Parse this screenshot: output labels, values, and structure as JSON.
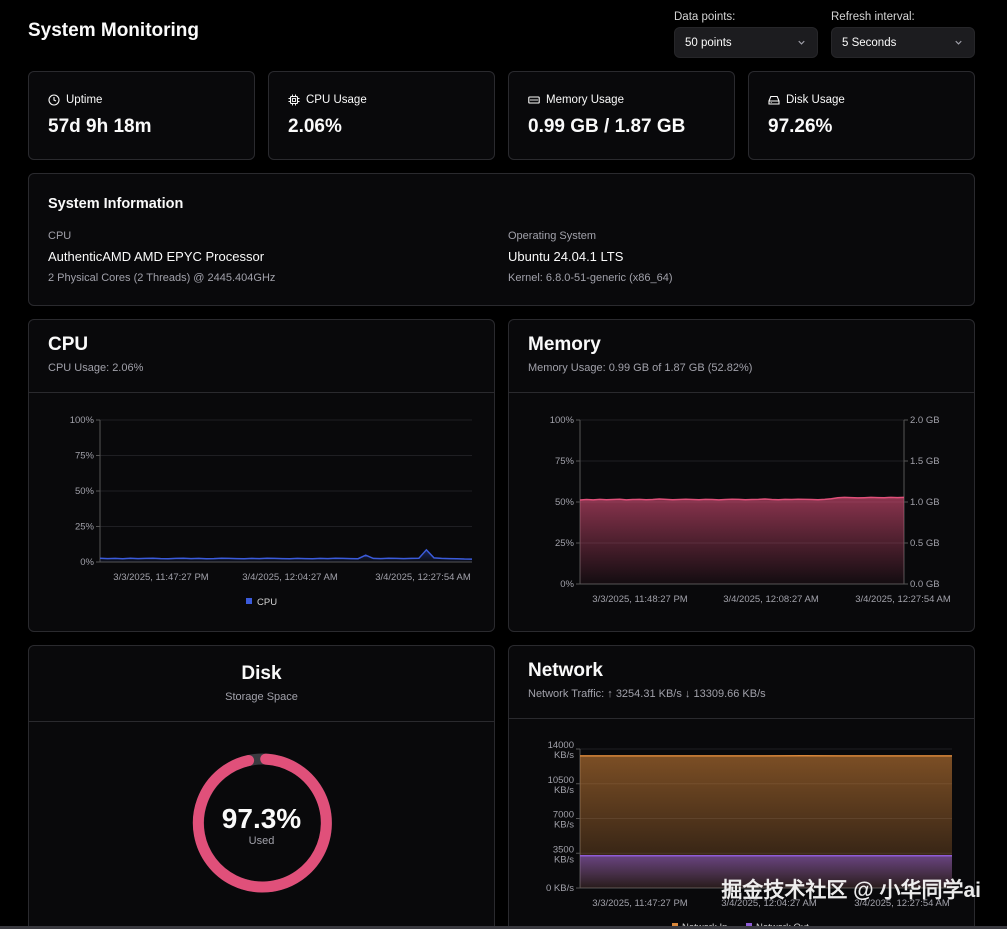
{
  "title": "System Monitoring",
  "controls": {
    "data_points_label": "Data points:",
    "data_points_value": "50 points",
    "refresh_label": "Refresh interval:",
    "refresh_value": "5 Seconds"
  },
  "stats": {
    "uptime": {
      "label": "Uptime",
      "value": "57d 9h 18m",
      "icon": "clock-icon"
    },
    "cpu": {
      "label": "CPU Usage",
      "value": "2.06%",
      "icon": "cpu-icon"
    },
    "memory": {
      "label": "Memory Usage",
      "value": "0.99 GB / 1.87 GB",
      "icon": "memory-icon"
    },
    "disk": {
      "label": "Disk Usage",
      "value": "97.26%",
      "icon": "hard-drive-icon"
    }
  },
  "system_info": {
    "title": "System Information",
    "cpu": {
      "label": "CPU",
      "value": "AuthenticAMD AMD EPYC Processor",
      "detail": "2 Physical Cores (2 Threads) @ 2445.404GHz"
    },
    "os": {
      "label": "Operating System",
      "value": "Ubuntu 24.04.1 LTS",
      "detail": "Kernel: 6.8.0-51-generic (x86_64)"
    }
  },
  "cpu_panel": {
    "title": "CPU",
    "subtitle": "CPU Usage: 2.06%"
  },
  "memory_panel": {
    "title": "Memory",
    "subtitle": "Memory Usage: 0.99 GB of 1.87 GB (52.82%)"
  },
  "disk_panel": {
    "title": "Disk",
    "subtitle": "Storage Space",
    "gauge_value": "97.3%",
    "gauge_label": "Used",
    "used_fraction": 0.973
  },
  "network_panel": {
    "title": "Network",
    "subtitle": "Network Traffic: ↑ 3254.31 KB/s ↓ 13309.66 KB/s"
  },
  "colors": {
    "cpu": "#3b5bdb",
    "memory": "#e0507a",
    "network_in": "#d9873a",
    "network_out": "#8e5bd6",
    "disk": "#e0507a"
  },
  "watermark": "掘金技术社区 @ 小华同学ai",
  "chart_data": [
    {
      "type": "line",
      "name": "cpu",
      "yticks": [
        "0%",
        "25%",
        "50%",
        "75%",
        "100%"
      ],
      "ylim": [
        0,
        100
      ],
      "xticks": [
        "3/3/2025, 11:47:27 PM",
        "3/4/2025, 12:04:27 AM",
        "3/4/2025, 12:27:54 AM"
      ],
      "legend": [
        "CPU"
      ],
      "series": [
        {
          "name": "CPU",
          "values": [
            2.6,
            2.4,
            2.5,
            2.3,
            2.6,
            2.4,
            2.5,
            2.7,
            2.4,
            2.3,
            2.5,
            2.6,
            2.4,
            2.5,
            2.3,
            2.4,
            2.6,
            2.5,
            2.4,
            2.3,
            2.5,
            2.4,
            2.6,
            2.5,
            2.4,
            2.3,
            2.5,
            2.4,
            2.3,
            2.5,
            2.4,
            2.6,
            2.5,
            2.4,
            2.3,
            4.8,
            2.5,
            2.4,
            2.6,
            2.5,
            2.4,
            2.5,
            2.7,
            8.6,
            2.9,
            2.5,
            2.4,
            2.3,
            2.1,
            2.06
          ]
        }
      ]
    },
    {
      "type": "area",
      "name": "memory",
      "yticks": [
        "0%",
        "25%",
        "50%",
        "75%",
        "100%"
      ],
      "ylim": [
        0,
        100
      ],
      "y2ticks": [
        "0.0 GB",
        "0.5 GB",
        "1.0 GB",
        "1.5 GB",
        "2.0 GB"
      ],
      "y2lim": [
        0,
        2
      ],
      "xticks": [
        "3/3/2025, 11:48:27 PM",
        "3/4/2025, 12:08:27 AM",
        "3/4/2025, 12:27:54 AM"
      ],
      "series": [
        {
          "name": "Memory",
          "values": [
            51.2,
            51.5,
            51.3,
            51.6,
            51.4,
            51.5,
            51.7,
            51.3,
            51.5,
            51.6,
            51.4,
            51.5,
            51.8,
            51.6,
            51.4,
            51.5,
            51.7,
            51.5,
            51.4,
            51.6,
            51.5,
            51.3,
            51.5,
            51.7,
            51.6,
            51.4,
            51.5,
            51.6,
            51.8,
            51.5,
            51.4,
            51.6,
            51.5,
            51.7,
            51.6,
            51.5,
            51.4,
            51.6,
            52.0,
            52.6,
            52.8,
            52.7,
            52.5,
            52.6,
            52.8,
            52.7,
            52.6,
            52.8,
            52.7,
            52.82
          ]
        }
      ]
    },
    {
      "type": "area",
      "name": "network",
      "yticks": [
        "0 KB/s",
        "3500 KB/s",
        "7000 KB/s",
        "10500 KB/s",
        "14000 KB/s"
      ],
      "ylim": [
        0,
        14000
      ],
      "xticks": [
        "3/3/2025, 11:47:27 PM",
        "3/4/2025, 12:04:27 AM",
        "3/4/2025, 12:27:54 AM"
      ],
      "legend": [
        "Network In",
        "Network Out"
      ],
      "series": [
        {
          "name": "Network In",
          "values": [
            13300,
            13310,
            13305,
            13310,
            13300,
            13308,
            13312,
            13305,
            13300,
            13310,
            13309.66
          ]
        },
        {
          "name": "Network Out",
          "values": [
            3250,
            3254,
            3252,
            3255,
            3250,
            3253,
            3256,
            3252,
            3250,
            3254,
            3254.31
          ]
        }
      ]
    }
  ]
}
